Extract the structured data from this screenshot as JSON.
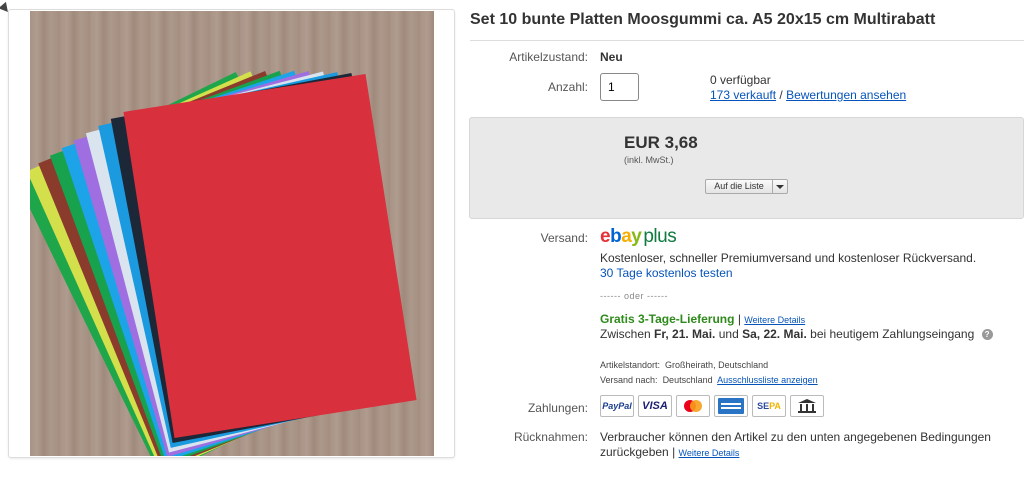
{
  "title": "Set 10 bunte Platten Moosgummi ca. A5 20x15 cm Multirabatt",
  "condition": {
    "label": "Artikelzustand:",
    "value": "Neu"
  },
  "quantity": {
    "label": "Anzahl:",
    "value": "1",
    "available": "0 verfügbar",
    "sold_link": "173 verkauft",
    "separator": "/",
    "reviews_link": "Bewertungen ansehen"
  },
  "price": {
    "amount": "EUR 3,68",
    "tax_note": "(inkl. MwSt.)",
    "watch_button": "Auf die Liste"
  },
  "shipping": {
    "label": "Versand:",
    "logo_ebay": "ebay",
    "logo_plus": "plus",
    "description": "Kostenloser, schneller Premiumversand und kostenloser Rückversand.",
    "trial_link": "30 Tage kostenlos testen",
    "or_separator": "------ oder ------",
    "free_delivery": "Gratis 3-Tage-Lieferung",
    "free_delivery_sep": "|",
    "details_link": "Weitere Details",
    "between_text": "Zwischen",
    "date_from": "Fr, 21. Mai.",
    "and_text": "und",
    "date_to": "Sa, 22. Mai.",
    "payment_note": "bei heutigem Zahlungseingang",
    "help_icon": "?",
    "location_label": "Artikelstandort:",
    "location_value": "Großheirath, Deutschland",
    "ships_to_label": "Versand nach:",
    "ships_to_value": "Deutschland",
    "exclusion_link": "Ausschlussliste anzeigen"
  },
  "payments": {
    "label": "Zahlungen:",
    "methods": [
      "PayPal",
      "VISA",
      "mastercard-icon",
      "amex-icon",
      "SEPA",
      "bank-transfer-icon"
    ],
    "paypal": "PayPal",
    "visa": "VISA",
    "sepa_se": "SE",
    "sepa_pa": "PA"
  },
  "returns": {
    "label": "Rücknahmen:",
    "text": "Verbraucher können den Artikel zu den unten angegebenen Bedingungen zurückgeben",
    "sep": "|",
    "details_link": "Weitere Details"
  },
  "colors": {
    "link": "#0654ba",
    "green": "#2e8b1b",
    "price_box": "#e9e9e9",
    "ebay_e": "#e53238",
    "ebay_b": "#0064d2",
    "ebay_a": "#f5af02",
    "ebay_y": "#86b817",
    "plus": "#0f7a3e"
  },
  "product_image": {
    "sheet_colors": [
      "#1fa64a",
      "#d4e04b",
      "#8a3b2c",
      "#18a24e",
      "#1da4e8",
      "#9f6ee0",
      "#d9e4ee",
      "#1b9ae0",
      "#1c2838",
      "#d8303c"
    ]
  }
}
